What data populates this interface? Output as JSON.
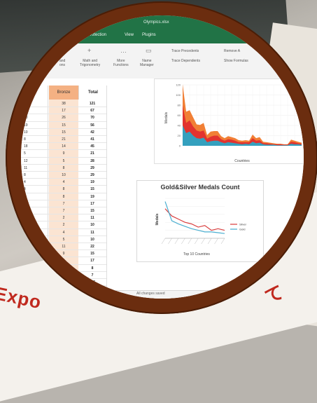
{
  "window": {
    "title": "Olympics.xlsx"
  },
  "menu": {
    "items": [
      "Protection",
      "View",
      "Plugins"
    ]
  },
  "ribbon": {
    "groups": [
      {
        "label": "Math and Trigonometry",
        "short": "Math and\nTrigonometry"
      },
      {
        "label": "More Functions",
        "short": "More\nFunctions"
      },
      {
        "label": "Name Manager",
        "short": "Name\nManager"
      }
    ],
    "left_fragment": "and\nons",
    "trace_precedents": "Trace Precedents",
    "trace_dependents": "Trace Dependents",
    "remove_arrows": "Remove A",
    "show_formulas": "Show Formulas"
  },
  "sheet": {
    "bronze_header": "Bronze",
    "total_header": "Total",
    "rows": [
      {
        "left": "",
        "bronze": "38",
        "total": "121"
      },
      {
        "left": "",
        "bronze": "17",
        "total": "67"
      },
      {
        "left": "",
        "bronze": "26",
        "total": "70"
      },
      {
        "left": "",
        "bronze": "15",
        "total": "56"
      },
      {
        "left": "",
        "bronze": "15",
        "total": "42"
      },
      {
        "left": "",
        "bronze": "21",
        "total": "41"
      },
      {
        "left": "",
        "bronze": "14",
        "total": "45"
      },
      {
        "left": "",
        "bronze": "9",
        "total": "21"
      },
      {
        "left": "",
        "bronze": "5",
        "total": "28"
      },
      {
        "left": "",
        "bronze": "8",
        "total": "29"
      },
      {
        "left": "",
        "bronze": "10",
        "total": "29"
      },
      {
        "left": "",
        "bronze": "4",
        "total": "19"
      },
      {
        "left": "",
        "bronze": "8",
        "total": "15"
      },
      {
        "left": "",
        "bronze": "8",
        "total": "19"
      },
      {
        "left": "",
        "bronze": "7",
        "total": "17"
      },
      {
        "left": "",
        "bronze": "7",
        "total": "15"
      },
      {
        "left": "",
        "bronze": "2",
        "total": "11"
      },
      {
        "left": "",
        "bronze": "2",
        "total": "10"
      },
      {
        "left": "",
        "bronze": "4",
        "total": "11"
      },
      {
        "left": "",
        "bronze": "5",
        "total": "10"
      },
      {
        "left": "",
        "bronze": "11",
        "total": "22"
      },
      {
        "left": "",
        "bronze": "9",
        "total": "15"
      },
      {
        "left": "",
        "bronze": "8",
        "total": "17"
      },
      {
        "left": "",
        "bronze": "4",
        "total": "8"
      },
      {
        "left": "",
        "bronze": "",
        "total": "7"
      },
      {
        "left": "",
        "bronze": "",
        "total": "715"
      }
    ],
    "left_values": [
      "8",
      "13",
      "18",
      "19",
      "10",
      "8",
      "18",
      "5",
      "12",
      "11",
      "8",
      "4",
      "4",
      "4",
      "4",
      "7",
      "2",
      "3",
      "3",
      "1",
      "5",
      "3",
      "3",
      "4",
      "",
      ""
    ]
  },
  "chart1": {
    "ylabel": "Medals",
    "xlabel": "Countries",
    "yticks": [
      "0",
      "20",
      "40",
      "60",
      "80",
      "100",
      "120"
    ]
  },
  "chart2": {
    "title": "Gold&Silver Medals Count",
    "ylabel": "Medals",
    "xlabel": "Top 10 Countries",
    "legend": [
      "Silver",
      "Gold"
    ],
    "colors": {
      "silver": "#d94040",
      "gold": "#4aaed0"
    }
  },
  "chart_data": [
    {
      "type": "area",
      "ylabel": "Medals",
      "xlabel": "Countries",
      "ylim": [
        0,
        120
      ],
      "series": [
        {
          "values": [
            121,
            67,
            70,
            56,
            42,
            41,
            45,
            21,
            28,
            29,
            29,
            19,
            15,
            19,
            17,
            15,
            11,
            10,
            11,
            10,
            22,
            15,
            17,
            8,
            7,
            6,
            5,
            4,
            4,
            3,
            3,
            12,
            10,
            8,
            6
          ]
        },
        {
          "values": [
            80,
            45,
            50,
            38,
            30,
            28,
            30,
            14,
            18,
            20,
            20,
            13,
            10,
            13,
            12,
            10,
            7,
            7,
            7,
            7,
            15,
            10,
            11,
            5,
            5,
            4,
            3,
            3,
            3,
            2,
            2,
            8,
            7,
            5,
            4
          ]
        },
        {
          "values": [
            40,
            25,
            28,
            20,
            15,
            14,
            16,
            7,
            9,
            10,
            10,
            7,
            5,
            7,
            6,
            5,
            4,
            3,
            4,
            3,
            8,
            5,
            6,
            3,
            2,
            2,
            2,
            1,
            1,
            1,
            1,
            4,
            3,
            3,
            2
          ]
        }
      ]
    },
    {
      "type": "line",
      "title": "Gold&Silver Medals Count",
      "ylabel": "Medals",
      "xlabel": "Top 10 Countries",
      "ylim": [
        0,
        50
      ],
      "series": [
        {
          "name": "Silver",
          "values": [
            37,
            28,
            24,
            20,
            18,
            14,
            16,
            10,
            12,
            10
          ]
        },
        {
          "name": "Gold",
          "values": [
            46,
            22,
            18,
            15,
            12,
            10,
            8,
            8,
            7,
            6
          ]
        }
      ]
    }
  ],
  "status": {
    "text": "All changes saved"
  },
  "banner": {
    "left": "Expo",
    "right": "て"
  }
}
